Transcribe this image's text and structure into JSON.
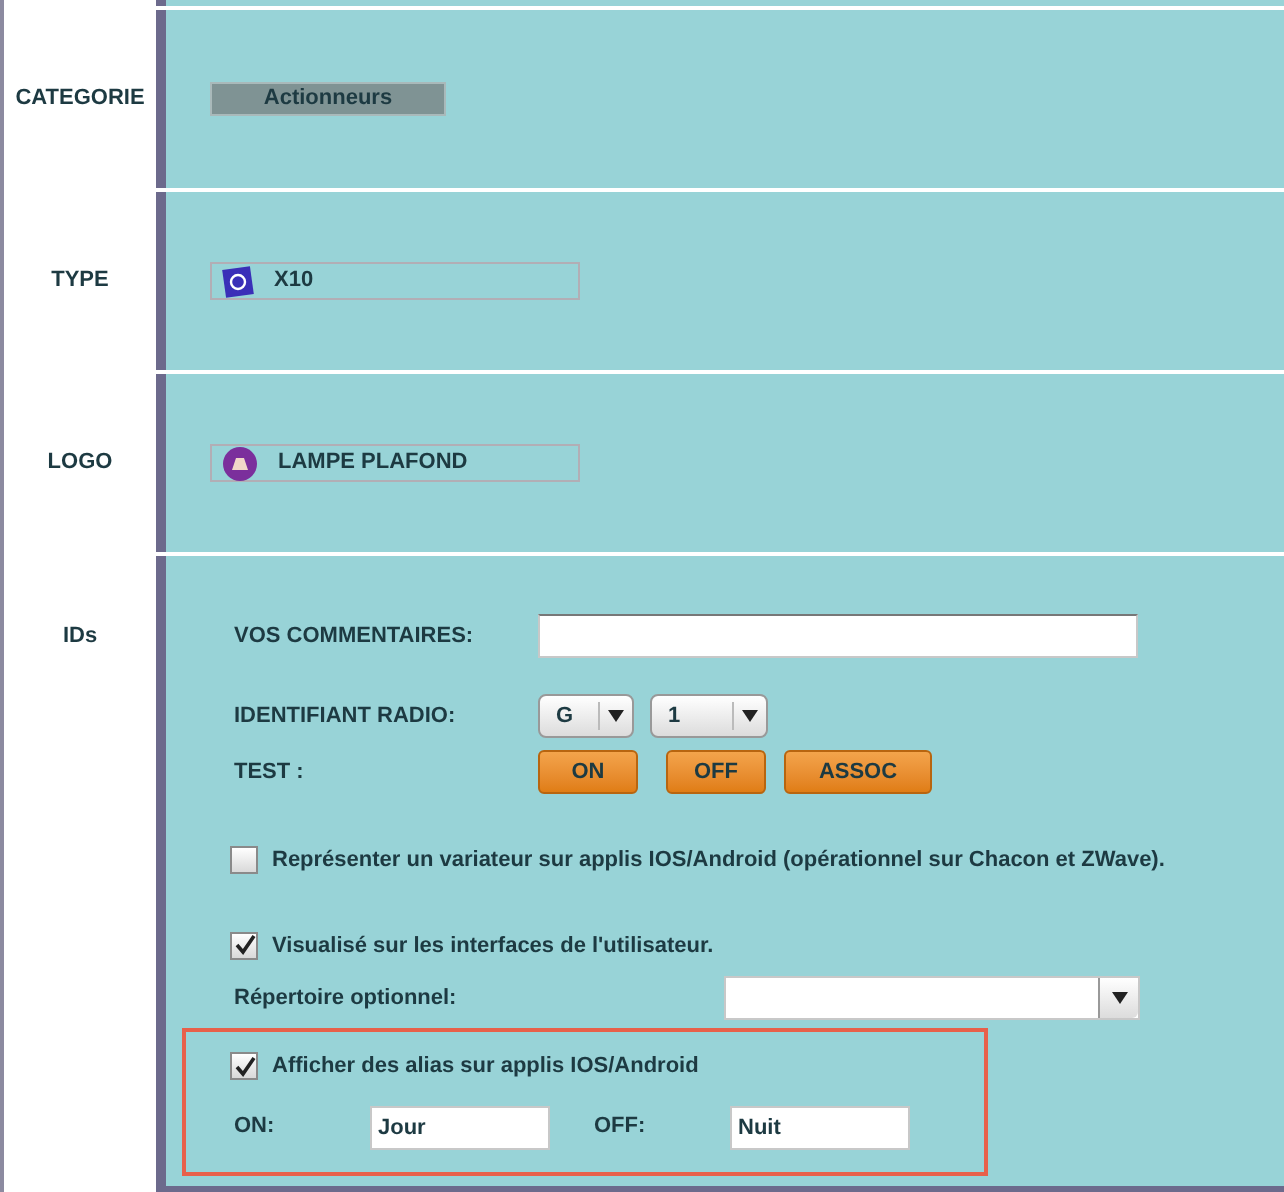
{
  "rows": [
    {
      "label": "CATEGORIE",
      "kind": "category",
      "value": "Actionneurs"
    },
    {
      "label": "TYPE",
      "kind": "type",
      "value": "X10"
    },
    {
      "label": "LOGO",
      "kind": "logo",
      "value": "LAMPE PLAFOND"
    }
  ],
  "ids": {
    "label": "IDs",
    "comments": {
      "label": "VOS COMMENTAIRES:"
    },
    "radio": {
      "label": "IDENTIFIANT RADIO:",
      "selects": [
        "G",
        "1"
      ]
    },
    "test": {
      "label": "TEST :",
      "buttons": [
        "ON",
        "OFF",
        "ASSOC"
      ]
    },
    "dimmer": {
      "label": "Représenter un variateur sur applis IOS/Android (opérationnel sur Chacon et ZWave).",
      "checked": false
    },
    "visible": {
      "label": "Visualisé sur les interfaces de l'utilisateur.",
      "checked": true
    },
    "folder": {
      "label": "Répertoire optionnel:"
    },
    "alias": {
      "label": "Afficher des alias sur applis IOS/Android",
      "checked": true,
      "on": {
        "label": "ON:",
        "value": "Jour"
      },
      "off": {
        "label": "OFF:",
        "value": "Nuit"
      }
    }
  }
}
